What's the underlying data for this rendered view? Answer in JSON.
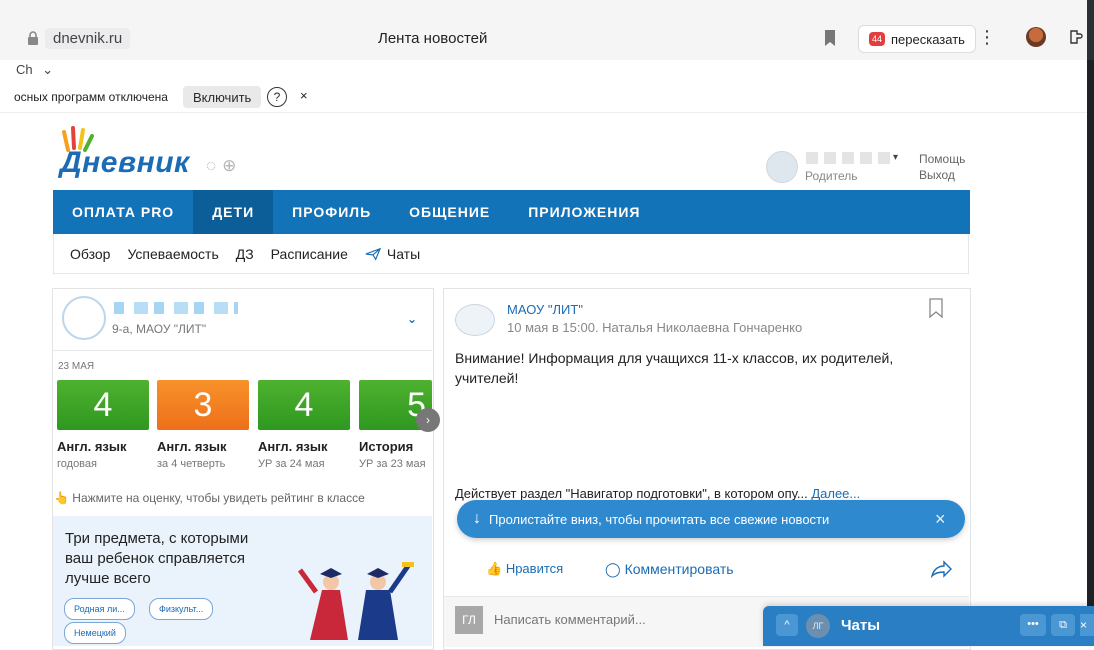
{
  "browser": {
    "domain": "dnevnik.ru",
    "page_title": "Лента новостей",
    "retell_label": "пересказать",
    "retell_badge": "44",
    "menu_dots": "⋮",
    "profile_label": "Ch",
    "profile_caret": "⌄"
  },
  "plugin_bar": {
    "message": "осных программ отключена",
    "enable_label": "Включить",
    "help_label": "?",
    "close_label": "×"
  },
  "site": {
    "logo_text": "Дневник",
    "user_role": "Родитель",
    "user_caret": "▾",
    "help_label": "Помощь",
    "logout_label": "Выход"
  },
  "mainnav": [
    "ОПЛАТА PRO",
    "ДЕТИ",
    "ПРОФИЛЬ",
    "ОБЩЕНИЕ",
    "ПРИЛОЖЕНИЯ"
  ],
  "mainnav_active": "ДЕТИ",
  "subnav": {
    "items": [
      "Обзор",
      "Успеваемость",
      "ДЗ",
      "Расписание"
    ],
    "chats": "Чаты"
  },
  "child": {
    "class_info": "9-а, МАОУ \"ЛИТ\"",
    "chevron": "⌄"
  },
  "grades": {
    "date": "23 МАЯ",
    "items": [
      {
        "mark": "4",
        "subject": "Англ. язык",
        "note": "годовая",
        "color": "green"
      },
      {
        "mark": "3",
        "subject": "Англ. язык",
        "note": "за 4 четверть",
        "color": "orange"
      },
      {
        "mark": "4",
        "subject": "Англ. язык",
        "note": "УР за 24 мая",
        "color": "green"
      },
      {
        "mark": "5",
        "subject": "История",
        "note": "УР за 23 мая",
        "color": "green"
      }
    ],
    "next_label": "›",
    "hint": "Нажмите на оценку, чтобы увидеть рейтинг в классе",
    "hint_icon": "👆"
  },
  "promo": {
    "title": "Три предмета, с которыми ваш ребенок справляется лучше всего",
    "pills": [
      "Родная ли...",
      "Физкульт...",
      "Немецкий"
    ]
  },
  "post": {
    "author": "МАОУ \"ЛИТ\"",
    "meta": "10 мая в 15:00. Наталья Николаевна Гончаренко",
    "text": "Внимание! Информация для учащихся 11-х классов, их родителей, учителей!",
    "preview": "Действует раздел \"Навигатор подготовки\", в котором опу...",
    "more_label": "Далее...",
    "like_label": "Нравится",
    "comment_label": "Комментировать",
    "comment_avatar": "ГЛ",
    "comment_placeholder": "Написать комментарий..."
  },
  "toast": {
    "text": "Пролистайте вниз, чтобы прочитать все свежие новости",
    "close_label": "×"
  },
  "chats_panel": {
    "title": "Чаты",
    "avatar": "ЛГ",
    "up_label": "^",
    "more_label": "•••",
    "open_label": "⧉",
    "close_label": "×"
  },
  "colors": {
    "brand_blue": "#1373b8",
    "grade_green": "#3aa526",
    "grade_orange": "#f27f22",
    "toast_blue": "#2f89cf"
  }
}
